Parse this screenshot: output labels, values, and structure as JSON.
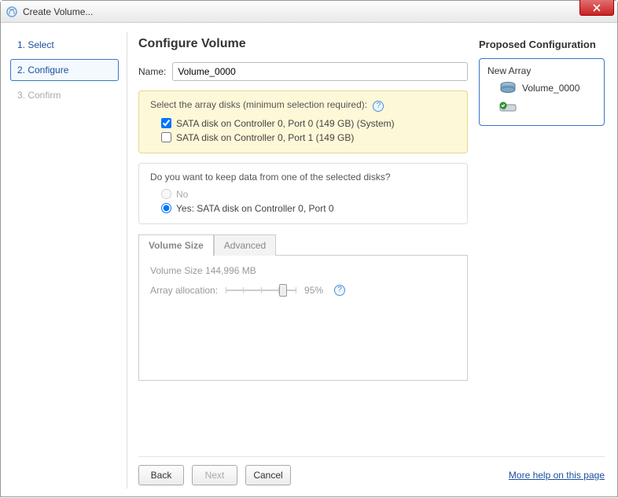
{
  "window": {
    "title": "Create Volume..."
  },
  "sidebar": {
    "steps": [
      {
        "label": "1. Select"
      },
      {
        "label": "2. Configure"
      },
      {
        "label": "3. Confirm"
      }
    ]
  },
  "page": {
    "title": "Configure Volume",
    "name_label": "Name:",
    "name_value": "Volume_0000",
    "disk_section_title": "Select the array disks (minimum selection required):",
    "disks": [
      {
        "label": "SATA disk on Controller 0, Port 0 (149 GB) (System)",
        "checked": true
      },
      {
        "label": "SATA disk on Controller 0, Port 1 (149 GB)",
        "checked": false
      }
    ],
    "keep_question": "Do you want to keep data from one of the selected disks?",
    "keep_no": "No",
    "keep_yes": "Yes: SATA disk on Controller 0, Port 0",
    "tabs": {
      "size": "Volume Size",
      "advanced": "Advanced"
    },
    "volume_size_label": "Volume Size 144,996 MB",
    "allocation_label": "Array allocation:",
    "allocation_value": "95%"
  },
  "proposed": {
    "heading": "Proposed Configuration",
    "root": "New Array",
    "volume": "Volume_0000"
  },
  "footer": {
    "back": "Back",
    "next": "Next",
    "cancel": "Cancel",
    "help": "More help on this page"
  }
}
